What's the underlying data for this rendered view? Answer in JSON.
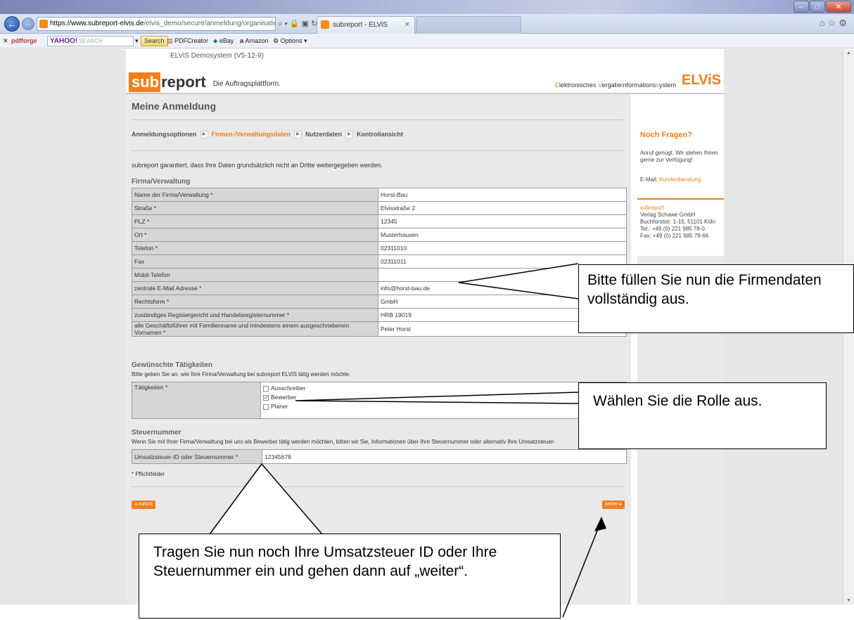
{
  "browser": {
    "address_domain": "https://www.subreport-elvis.de",
    "address_path": "/elvis_demo/secure/anmeldung/organisation_e",
    "tab_active": "subreport - ELViS",
    "toolbar": {
      "pdfforge": "pdfforge",
      "yahoo_label": "YAHOO!",
      "yahoo_search": "SEARCH",
      "search_button": "Search",
      "pdfcreator": "PDFCreator",
      "ebay": "eBay",
      "amazon": "Amazon",
      "options": "Options"
    }
  },
  "page": {
    "demo_label": "ELViS Demosystem (V5-12-9)",
    "logo_sub": "sub",
    "logo_report": "report",
    "logo_tagline": "Die Auftragsplattform.",
    "brand": {
      "e": "E",
      "lektronisches": "lektronisches ",
      "v": "V",
      "ergabe": "ergabe",
      "i": "i",
      "nformations": "nformations",
      "s": "s",
      "ystem": "ystem",
      "big": "ELViS"
    },
    "title": "Meine Anmeldung",
    "steps": [
      {
        "label": "Anmeldungsoptionen",
        "active": false
      },
      {
        "label": "Firmen-/Verwaltungsdaten",
        "active": true
      },
      {
        "label": "Nutzerdaten",
        "active": false
      },
      {
        "label": "Kontrollansicht",
        "active": false
      }
    ],
    "guarantee": "subreport garantiert, dass Ihre Daten grundsätzlich nicht an Dritte weitergegeben werden.",
    "firma_title": "Firma/Verwaltung",
    "firma_rows": [
      {
        "label": "Name der Firma/Verwaltung *",
        "value": "Horst-Bau"
      },
      {
        "label": "Straße *",
        "value": "Elvisstraße 2"
      },
      {
        "label": "PLZ *",
        "value": "12345"
      },
      {
        "label": "Ort *",
        "value": "Musterhausen"
      },
      {
        "label": "Telefon *",
        "value": "02311010"
      },
      {
        "label": "Fax",
        "value": "02311011"
      },
      {
        "label": "Mobil-Telefon",
        "value": ""
      },
      {
        "label": "zentrale E-Mail Adresse *",
        "value": "info@horst-bau.de"
      },
      {
        "label": "Rechtsform *",
        "value": "GmbH"
      },
      {
        "label": "zuständiges Registergericht und Handelsregisternummer *",
        "value": "HRB 19019"
      },
      {
        "label": "alle Geschäftsführer mit Familienname und mindestens einem ausgeschriebenen Vornamen *",
        "value": "Peter Horst"
      }
    ],
    "taetigkeiten_title": "Gewünschte Tätigkeiten",
    "taetigkeiten_sub": "Bitte geben Sie an, wie Ihre Firma/Verwaltung bei subreport ELViS tätig werden möchte.",
    "taetigkeiten_label": "Tätigkeiten *",
    "taetigkeiten_options": [
      {
        "label": "Ausschreiber",
        "checked": false
      },
      {
        "label": "Bewerber",
        "checked": true
      },
      {
        "label": "Planer",
        "checked": false
      }
    ],
    "steuer_title": "Steuernummer",
    "steuer_sub": "Wenn Sie mit Ihrer Firma/Verwaltung bei uns als Bewerber tätig werden möchten, bitten wir Sie, Informationen über Ihre Steuernummer oder alternativ Ihre Umsatzsteuer-",
    "steuer_label": "Umsatzsteuer-ID oder Steuernummer *",
    "steuer_value": "12345678",
    "pflicht": "* Pflichtfelder",
    "back_button": "◂ zurück",
    "next_button": "weiter ▸"
  },
  "sidebar": {
    "title": "Noch Fragen?",
    "text": "Anruf genügt. Wir stehen Ihnen gerne zur Verfügung!",
    "email_prefix": "E-Mail: ",
    "email_link": "Kundenberatung",
    "company": "subreport",
    "address_lines": [
      "Verlag Schawe GmbH",
      "Buchforststr. 1-15, 51101 Köln",
      "Tel.: +49 (0) 221 985 78-0",
      "Fax: +49 (0) 221 985 78-66"
    ]
  },
  "callouts": {
    "firmendaten": "Bitte füllen Sie nun die Firmendaten vollständig aus.",
    "rolle": "Wählen Sie die Rolle aus.",
    "steuer": "Tragen Sie nun noch Ihre Umsatzsteuer ID oder Ihre Steuernummer ein und gehen dann auf „weiter“."
  }
}
